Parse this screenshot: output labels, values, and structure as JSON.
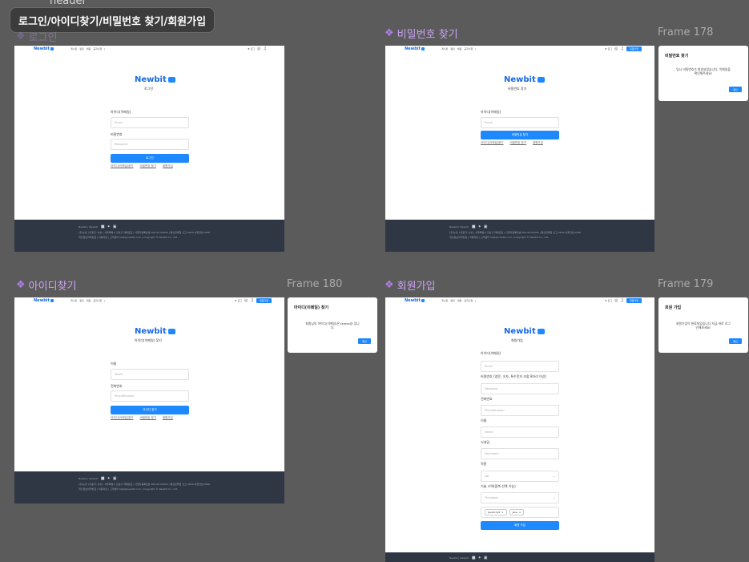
{
  "header_peek": "header",
  "section_title": "로그인/아이디찾기/비밀번호 찾기/회원가입",
  "components": {
    "login": "로그인",
    "find_pw": "비밀번호 찾기",
    "find_id": "아이디찾기",
    "signup": "회원가입"
  },
  "frames": {
    "f178": "Frame 178",
    "f180": "Frame 180",
    "f179": "Frame 179"
  },
  "nav": {
    "logo": "Newbit",
    "links": [
      "게시판",
      "랭킹",
      "채용",
      "공지사항"
    ],
    "menu_toggle": "|",
    "lang": "❖ 로그",
    "cta": "회원가입",
    "chat_icon": "chat-icon",
    "bell_icon": "bell-icon"
  },
  "brand": "Newbit",
  "login": {
    "subtitle": "로그인",
    "id_label": "아이디(이메일)",
    "id_placeholder": "Email",
    "pw_label": "비밀번호",
    "pw_placeholder": "Password",
    "button": "로그인",
    "links": [
      "아이디(이메일)찾기",
      "비밀번호 찾기",
      "회원가입"
    ]
  },
  "find_pw": {
    "subtitle": "비밀번호 찾기",
    "id_label": "아이디(이메일)",
    "id_placeholder": "Email",
    "button": "비밀번호 찾기",
    "links": [
      "아이디(이메일)찾기",
      "비밀번호 찾기",
      "회원가입"
    ]
  },
  "find_id": {
    "subtitle": "아이디(이메일) 찾기",
    "name_label": "이름",
    "name_placeholder": "Name",
    "phone_label": "전화번호",
    "phone_placeholder": "PhoneNumber",
    "button": "아이디 찾기",
    "links": [
      "아이디(이메일)찾기",
      "비밀번호 찾기",
      "회원가입"
    ]
  },
  "signup": {
    "subtitle": "회원가입",
    "id_label": "아이디(이메일)",
    "id_placeholder": "Email",
    "pw_label": "비밀번호 (영문, 숫자, 특수문자 조합 8자리 이상)",
    "pw_placeholder": "Password",
    "phone_label": "전화번호",
    "phone_placeholder": "PhoneNumber",
    "name_label": "이름",
    "name_placeholder": "Name",
    "nick_label": "닉네임",
    "nick_placeholder": "Nickname",
    "job_label": "직종",
    "job_value": "job",
    "stack_label": "기술 스택(중복 선택 가능)",
    "stack_value": "Techstack",
    "tags": [
      "JavaScript",
      "Java"
    ],
    "button": "회원 가입"
  },
  "footer": {
    "brand": "Newbit | Newbit",
    "line1": "(주)뉴빗 | 대표자: 뉴빗 | 서울특별시 강남구 테헤란로 | 사업자등록번호 000-00-00000 | 통신판매업 신고 0000-서울강남-0000",
    "line2": "개인정보처리방침 | 이용약관 | 고객센터 help@newbit.com | Copyright © Newbit Co., Ltd.",
    "social": [
      "facebook-icon",
      "twitter-icon",
      "instagram-icon"
    ]
  },
  "modals": {
    "pw": {
      "title": "비밀번호 찾기",
      "message": "임시 비밀번호가 발송되었습니다. 이메일을 확인해주세요!",
      "button": "확인"
    },
    "id": {
      "title": "아이디(이메일) 찾기",
      "message": "회원님의 아이디(이메일)은 james@ 입니다.",
      "button": "확인"
    },
    "signup": {
      "title": "회원 가입",
      "message": "회원가입이 완료되었습니다 지금 바로 로그인해보세요!",
      "button": "확인"
    }
  }
}
